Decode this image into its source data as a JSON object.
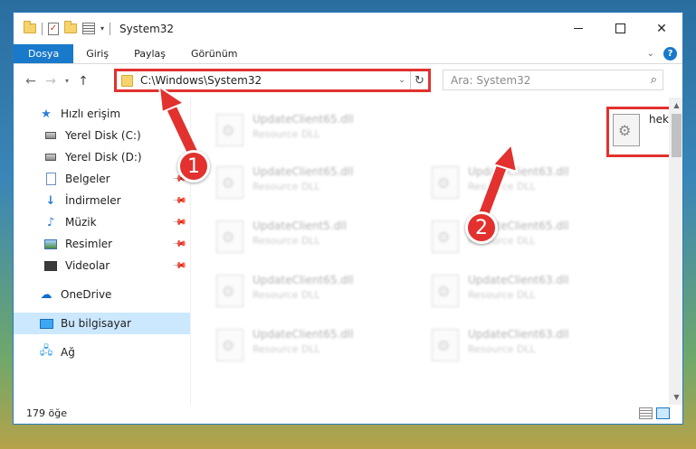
{
  "window": {
    "title": "System32"
  },
  "ribbon": {
    "tabs": [
      "Dosya",
      "Giriş",
      "Paylaş",
      "Görünüm"
    ],
    "help_label": "?"
  },
  "address": {
    "path": "C:\\Windows\\System32",
    "search_placeholder": "Ara: System32"
  },
  "nav": {
    "quick_access": "Hızlı erişim",
    "items": [
      {
        "label": "Yerel Disk (C:)",
        "pinned": false
      },
      {
        "label": "Yerel Disk (D:)",
        "pinned": false
      },
      {
        "label": "Belgeler",
        "pinned": true
      },
      {
        "label": "İndirmeler",
        "pinned": true
      },
      {
        "label": "Müzik",
        "pinned": true
      },
      {
        "label": "Resimler",
        "pinned": true
      },
      {
        "label": "Videolar",
        "pinned": true
      }
    ],
    "onedrive": "OneDrive",
    "this_pc": "Bu bilgisayar",
    "network": "Ağ"
  },
  "files": [
    {
      "name": "UpdateClient65.dll",
      "type": "Resource DLL"
    },
    {
      "name": "hekbmap.dll",
      "type": ""
    },
    {
      "name": "UpdateClient65.dll",
      "type": "Resource DLL"
    },
    {
      "name": "UpdateClient63.dll",
      "type": "Resource DLL"
    },
    {
      "name": "UpdateClient5.dll",
      "type": "Resource DLL"
    },
    {
      "name": "UpdateClient65.dll",
      "type": "Resource DLL"
    },
    {
      "name": "UpdateClient65.dll",
      "type": "Resource DLL"
    },
    {
      "name": "UpdateClient63.dll",
      "type": "Resource DLL"
    },
    {
      "name": "UpdateClient65.dll",
      "type": "Resource DLL"
    },
    {
      "name": "UpdateClient63.dll",
      "type": "Resource DLL"
    }
  ],
  "status": {
    "count": "179 öğe"
  },
  "annotations": {
    "step1": "1",
    "step2": "2",
    "color": "#e2312e"
  }
}
